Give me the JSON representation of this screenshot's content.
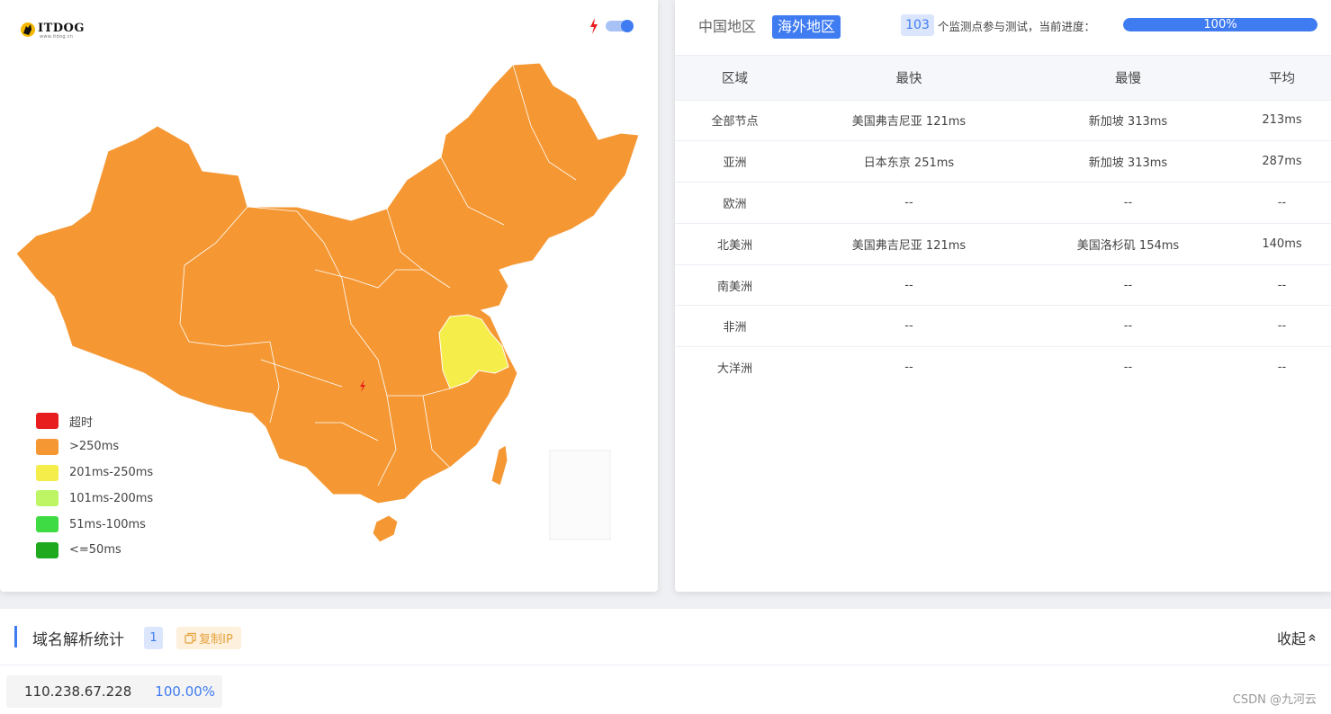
{
  "logo": {
    "text": "ITDOG",
    "sub": "www.itdog.cn"
  },
  "colors": {
    "accent": "#3f7bf1",
    "timeout": "#e81d1d",
    "gt250": "#f59834",
    "r201_250": "#f5ed4a",
    "r101_200": "#bdf565",
    "r51_100": "#3fdb44",
    "le50": "#1fa91f"
  },
  "legend": [
    {
      "label": "超时",
      "color": "#e81d1d"
    },
    {
      "label": ">250ms",
      "color": "#f59834"
    },
    {
      "label": "201ms-250ms",
      "color": "#f5ed4a"
    },
    {
      "label": "101ms-200ms",
      "color": "#bdf565"
    },
    {
      "label": "51ms-100ms",
      "color": "#3fdb44"
    },
    {
      "label": "<=50ms",
      "color": "#1fa91f"
    }
  ],
  "tabs": {
    "china": "中国地区",
    "overseas": "海外地区"
  },
  "progress": {
    "count": "103",
    "text": "个监测点参与测试，当前进度：",
    "percent_label": "100%",
    "value": 100
  },
  "table": {
    "headers": [
      "区域",
      "最快",
      "最慢",
      "平均"
    ],
    "rows": [
      [
        "全部节点",
        "美国弗吉尼亚 121ms",
        "新加坡 313ms",
        "213ms"
      ],
      [
        "亚洲",
        "日本东京 251ms",
        "新加坡 313ms",
        "287ms"
      ],
      [
        "欧洲",
        "--",
        "--",
        "--"
      ],
      [
        "北美洲",
        "美国弗吉尼亚 121ms",
        "美国洛杉矶 154ms",
        "140ms"
      ],
      [
        "南美洲",
        "--",
        "--",
        "--"
      ],
      [
        "非洲",
        "--",
        "--",
        "--"
      ],
      [
        "大洋洲",
        "--",
        "--",
        "--"
      ]
    ]
  },
  "dns": {
    "title": "域名解析统计",
    "count": "1",
    "copy_label": "复制IP",
    "collapse_label": "收起",
    "ip": "110.238.67.228",
    "percent": "100.00%"
  },
  "watermark": "CSDN @九河云"
}
